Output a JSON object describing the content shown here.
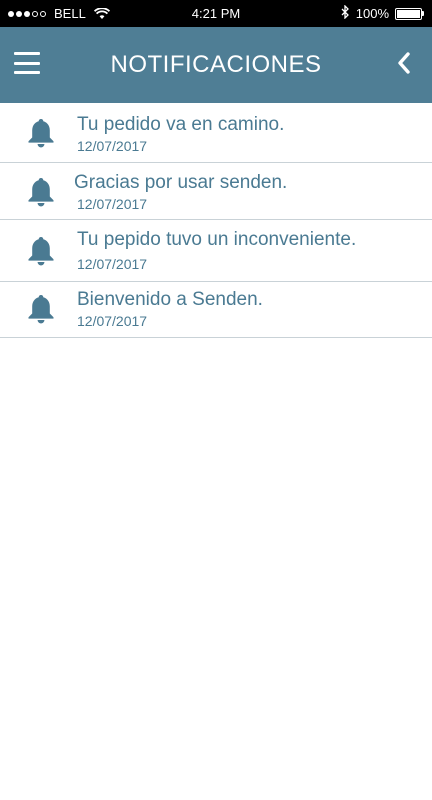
{
  "status_bar": {
    "carrier": "BELL",
    "time": "4:21 PM",
    "battery": "100%",
    "battery_level": 1.0,
    "signal_strength": 3,
    "signal_max": 5,
    "icons": [
      "signal-dots-icon",
      "wifi-icon",
      "bluetooth-icon",
      "battery-icon"
    ]
  },
  "app_bar": {
    "title": "NOTIFICACIONES",
    "background": "#4f7e95",
    "menu_icon": "hamburger-menu-icon",
    "back_icon": "chevron-left-icon"
  },
  "notifications": [
    {
      "title": "Tu pedido va en camino.",
      "date": "12/07/2017",
      "icon": "bell-icon"
    },
    {
      "title": "Gracias por usar senden.",
      "date": "12/07/2017",
      "icon": "bell-icon"
    },
    {
      "title": "Tu pepido tuvo un inconveniente.",
      "date": "12/07/2017",
      "icon": "bell-icon"
    },
    {
      "title": "Bienvenido a Senden.",
      "date": "12/07/2017",
      "icon": "bell-icon"
    }
  ],
  "colors": {
    "accent": "#4f7e95",
    "text": "#4a7a92",
    "divider": "#c9d2d7"
  }
}
